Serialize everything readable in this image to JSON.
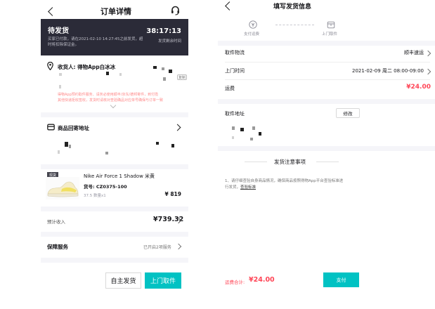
{
  "left": {
    "header": {
      "title": "订单详情"
    },
    "status": {
      "title": "待发货",
      "desc_line1": "买家已付款，请在2021-02-10 14:27:45之前发货，超",
      "desc_line2": "时将扣除保证金。",
      "countdown": "38:17:13",
      "countdown_label": "发货剩余时间"
    },
    "receiver": {
      "label": "收货人: 得物App白冰冰",
      "copy_label": "复制",
      "note_line1": "得物App预约取件服务、请务必使用顺丰/京东/德邦寄件，到付揽",
      "note_line2": "其他快递拒收签收，发货时请核对查验确品对应单号确保与订单一致"
    },
    "return_address": {
      "label": "商品回寄地址"
    },
    "product": {
      "badge": "现货",
      "name": "Nike Air Force 1 Shadow 米黄",
      "sku": "货号: CZ0375-100",
      "meta": "37.5 数量x1",
      "price": "¥ 819"
    },
    "income": {
      "label": "预计收入",
      "value": "¥739.32"
    },
    "service": {
      "label": "保障服务",
      "value": "已开启2项服务"
    },
    "footer": {
      "self_ship": "自主发货",
      "pickup": "上门取件"
    }
  },
  "right": {
    "header": {
      "title": "填写发货信息"
    },
    "steps": [
      {
        "label": "支付运费",
        "icon": "payment-icon"
      },
      {
        "label": "上门取件",
        "icon": "pickup-icon"
      }
    ],
    "courier": {
      "label": "取件物流",
      "value": "顺丰速运"
    },
    "pickup_time": {
      "label": "上门时间",
      "value": "2021-02-09 周二 08:00-09:00"
    },
    "shipping_fee": {
      "label": "运费",
      "value": "¥24.00"
    },
    "address": {
      "label": "取件地址",
      "edit_label": "修改"
    },
    "notice": {
      "title": "发货注意事项",
      "line1": "1、请仔细查验自身商品情况，确保商品按照得物App平台查验标准进",
      "line2_prefix": "行发货，",
      "link": "查验标准"
    },
    "footer": {
      "total_label": "运费合计:",
      "total_value": "¥24.00",
      "pay_label": "支付"
    }
  },
  "colors": {
    "accent_teal": "#01c2c3",
    "price_red": "#ff4657",
    "banner_dark": "#2b2b38"
  }
}
